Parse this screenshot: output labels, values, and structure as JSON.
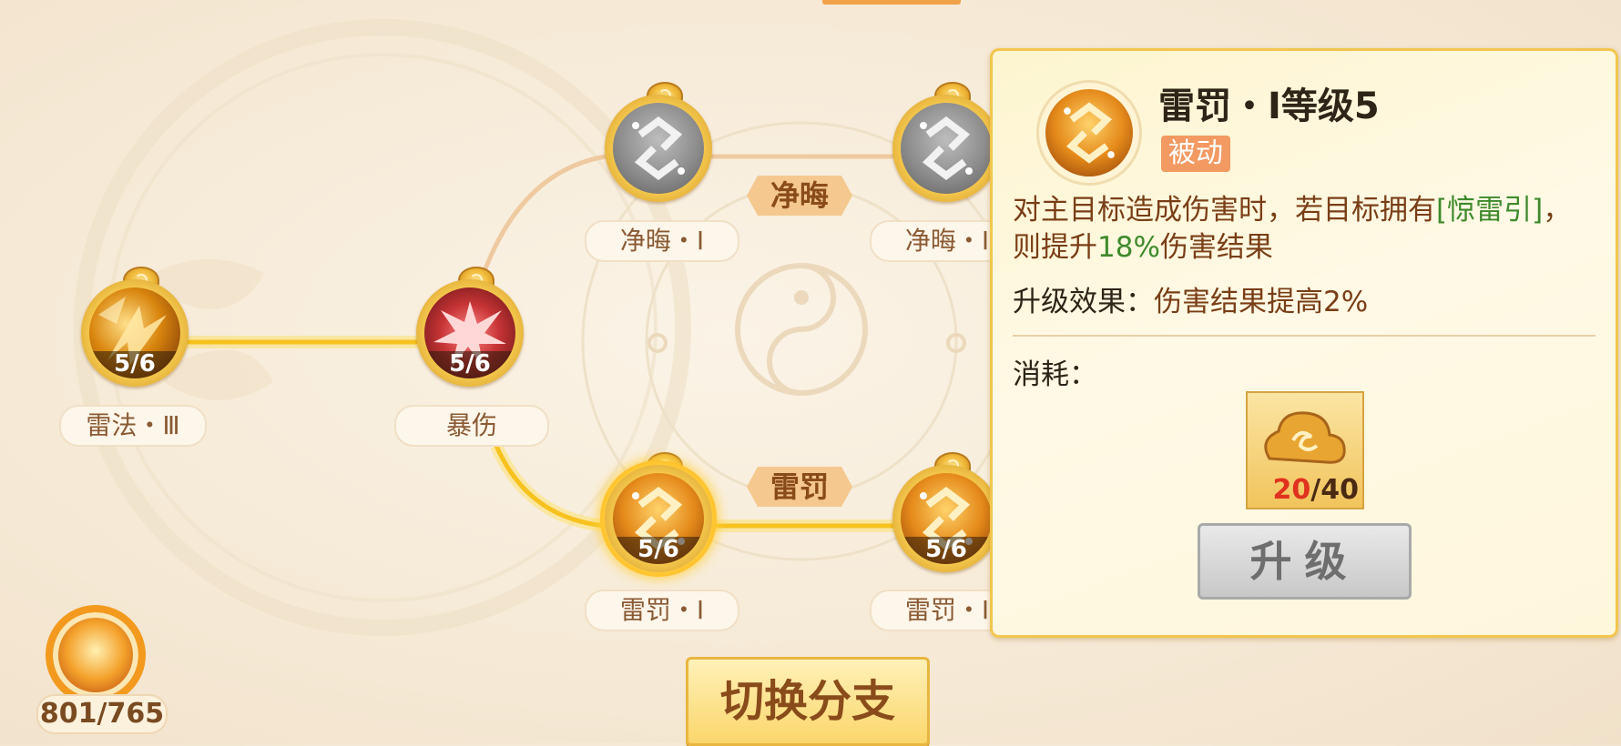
{
  "colors": {
    "accent": "#f2c64e",
    "highlight_green": "#3f8a2b",
    "cost_red": "#e0321e"
  },
  "skill_tree": {
    "nodes": [
      {
        "id": "leifa3",
        "label": "雷法・Ⅲ",
        "count": "5/6",
        "icon": "fire-rune-icon"
      },
      {
        "id": "baoshang",
        "label": "暴伤",
        "count": "5/6",
        "icon": "critical-burst-icon"
      },
      {
        "id": "jinghui1",
        "label": "净晦・Ⅰ",
        "icon": "gray-rune-icon"
      },
      {
        "id": "jinghui2",
        "label": "净晦・Ⅰ",
        "icon": "gray-rune-icon"
      },
      {
        "id": "leifa_pun1",
        "label": "雷罚・Ⅰ",
        "count": "5/6",
        "icon": "thunder-rune-icon"
      },
      {
        "id": "leifa_pun2",
        "label": "雷罚・Ⅰ",
        "count": "5/6",
        "icon": "thunder-rune-icon"
      }
    ],
    "branches": [
      "净晦",
      "雷罚"
    ]
  },
  "resource": {
    "value": "801/765",
    "icon": "flame-orb-icon"
  },
  "switch_branch_label": "切换分支",
  "detail": {
    "title": "雷罚・Ⅰ等级5",
    "type_badge": "被动",
    "desc_part1": "对主目标造成伤害时，若目标拥有",
    "desc_hl1": "[惊雷引]",
    "desc_part2": "，则提升",
    "desc_hl2": "18%",
    "desc_part3": "伤害结果",
    "upgrade_label": "升级效果：",
    "upgrade_value": "伤害结果提高2%",
    "cost_label": "消耗：",
    "cost_item": {
      "icon": "golden-cloud-icon",
      "have": "20",
      "need": "/40"
    },
    "upgrade_button": "升级"
  }
}
